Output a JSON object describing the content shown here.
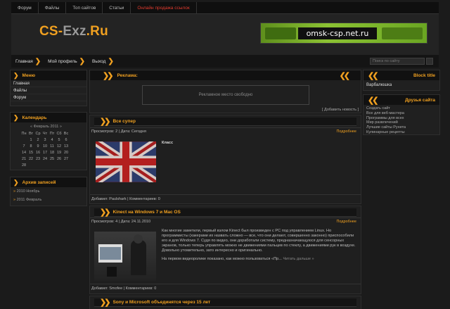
{
  "topnav": {
    "items": [
      "Форум",
      "Файлы",
      "Топ сайтов",
      "Статьи",
      "Онлайн продажа ссылок"
    ]
  },
  "header": {
    "logo_a": "CS-",
    "logo_b": "Exz",
    "logo_c": ".Ru",
    "banner_text": "omsk-csp.net.ru"
  },
  "crumbs": {
    "items": [
      "Главная",
      "Мой профиль",
      "Выход"
    ],
    "search_placeholder": "Поиск по сайту"
  },
  "left": {
    "menu_title": "Меню",
    "menu_items": [
      "Главная",
      "Файлы",
      "Форум"
    ],
    "calendar_title": "Календарь",
    "calendar_month": "« Февраль 2011 »",
    "calendar_days": [
      "Пн",
      "Вт",
      "Ср",
      "Чт",
      "Пт",
      "Сб",
      "Вс"
    ],
    "calendar_rows": [
      [
        "",
        "1",
        "2",
        "3",
        "4",
        "5",
        "6"
      ],
      [
        "7",
        "8",
        "9",
        "10",
        "11",
        "12",
        "13"
      ],
      [
        "14",
        "15",
        "16",
        "17",
        "18",
        "19",
        "20"
      ],
      [
        "21",
        "22",
        "23",
        "24",
        "25",
        "26",
        "27"
      ],
      [
        "28",
        "",
        "",
        "",
        "",
        "",
        ""
      ]
    ],
    "archive_title": "Архив записей",
    "archive_items": [
      "2010 Ноябрь",
      "2011 Февраль"
    ]
  },
  "main": {
    "ad_title": "Реклама:",
    "ad_placeholder": "Рекламное место свободно",
    "add_news": "[ Добавить новость ]",
    "posts": [
      {
        "title": "Все супер",
        "meta": "Просмотров: 2 | Дата: Сегодня",
        "more": "Подробнее",
        "caption": "Класс",
        "footer": "Добавил: Paulshark | Комментариев: 0"
      },
      {
        "title": "Kinect на Windows 7 и Mac OS",
        "meta": "Просмотров: 4 | Дата: 24.11.2010",
        "more": "Подробнее",
        "text": "Как многие заметили, первый взлом Kinect был произведен с PC под управлением Linux. Но программисты (хакерами их назвать сложно — все, что они делают, совершенно законно) приспособили его и для Windows 7. Судя по видео, они доработали систему, предназначающуюся для сенсорных экранов, только теперь управлять можно не движениями пальцев по стеклу, а движениями рук в воздухе. Довольно утомительно, зато интересно и оригинально.",
        "text2": "На первом видеоролике показано, как можно пользоваться «Пр...",
        "read_more": "Читать дальше »",
        "footer": "Добавил: Smofee | Комментариев: 0"
      },
      {
        "title": "Sony и Microsoft объединятся через 15 лет"
      }
    ]
  },
  "right": {
    "block_title": "Block title",
    "block_item": "Варбалюшка",
    "friends_title": "Друзья сайта",
    "friends": [
      "Создать сайт",
      "Все для веб-мастера",
      "Программы для всех",
      "Мир развлечений",
      "Лучшие сайты Рунета",
      "Кулинарные рецепты"
    ]
  },
  "colors": {
    "accent": "#f0a020",
    "bg": "#1b1b1b",
    "red_link": "#e23b2e"
  }
}
